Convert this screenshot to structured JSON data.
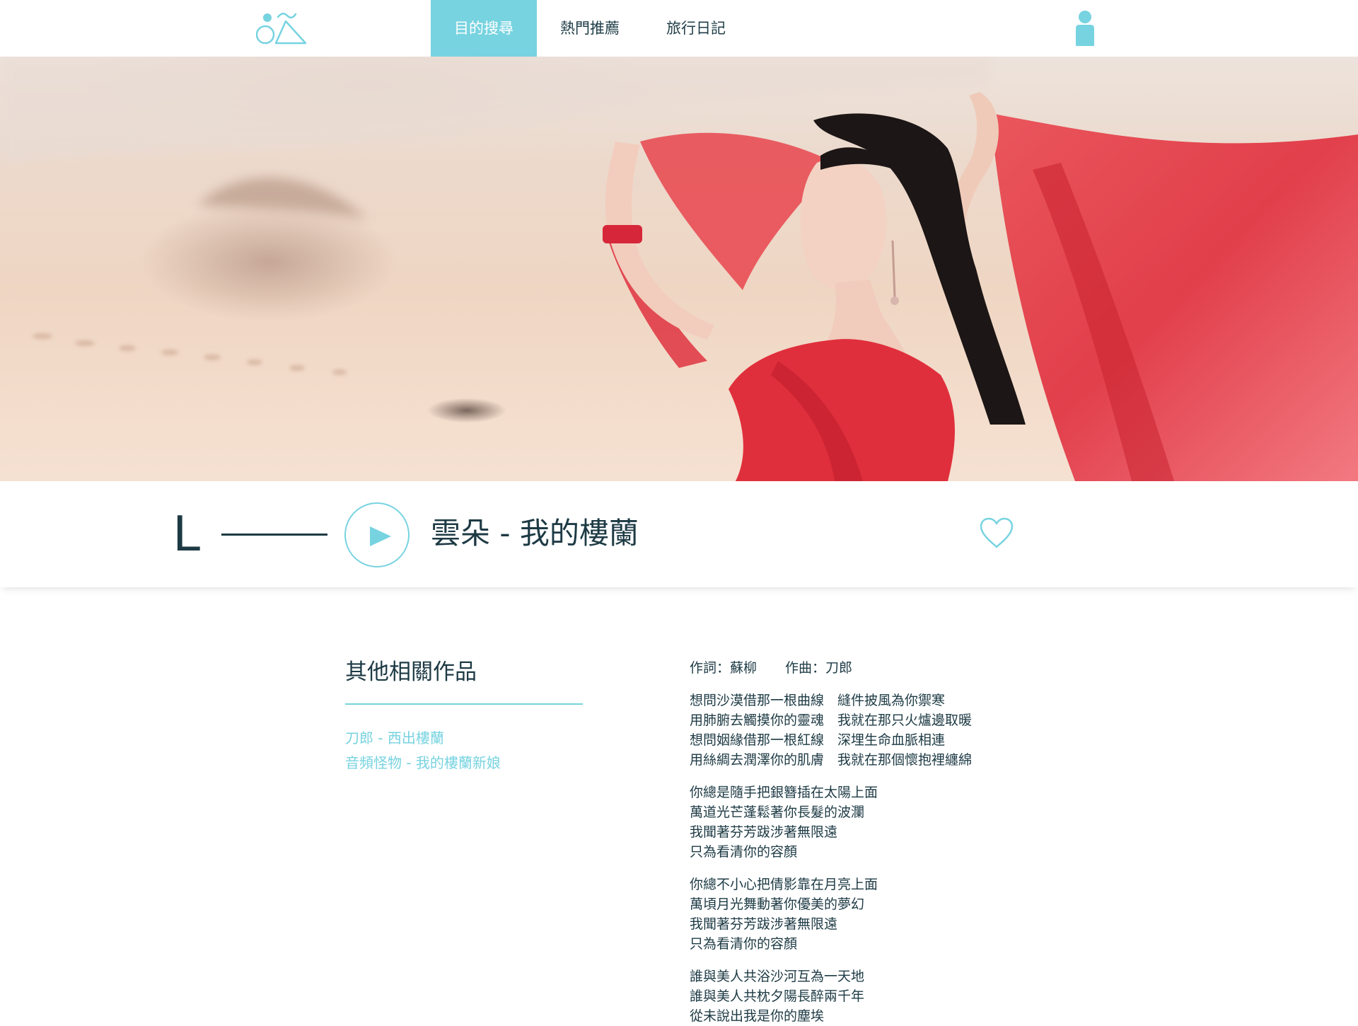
{
  "nav": {
    "items": [
      {
        "label": "目的搜尋",
        "active": true
      },
      {
        "label": "熱門推薦",
        "active": false
      },
      {
        "label": "旅行日記",
        "active": false
      }
    ]
  },
  "player": {
    "letter": "L",
    "song_title": "雲朵 - 我的樓蘭"
  },
  "related": {
    "title": "其他相關作品",
    "items": [
      "刀郎 - 西出樓蘭",
      "音頻怪物 - 我的樓蘭新娘"
    ]
  },
  "lyrics": {
    "lyricist": "作詞：蘇柳",
    "composer": "作曲：刀郎",
    "stanzas": [
      [
        "想問沙漠借那一根曲線　縫件披風為你禦寒",
        "用肺腑去觸摸你的靈魂　我就在那只火爐邊取暖",
        "想問姻緣借那一根紅線　深埋生命血脈相連",
        "用絲綢去潤澤你的肌膚　我就在那個懷抱裡纏綿"
      ],
      [
        "你總是隨手把銀簪插在太陽上面",
        "萬道光芒蓬鬆著你長髮的波瀾",
        "我聞著芬芳跋涉著無限遠",
        "只為看清你的容顏"
      ],
      [
        "你總不小心把倩影靠在月亮上面",
        "萬頃月光舞動著你優美的夢幻",
        "我聞著芬芳跋涉著無限遠",
        "只為看清你的容顏"
      ],
      [
        "誰與美人共浴沙河互為一天地",
        "誰與美人共枕夕陽長醉兩千年",
        "從未說出我是你的塵埃"
      ]
    ]
  },
  "colors": {
    "accent": "#77d3e0",
    "text": "#1d3a44",
    "scarf_red": "#e23a42"
  },
  "icons": {
    "logo": "bicycle-mountain-logo",
    "user": "user-icon",
    "play": "play-icon",
    "favorite": "heart-icon"
  }
}
